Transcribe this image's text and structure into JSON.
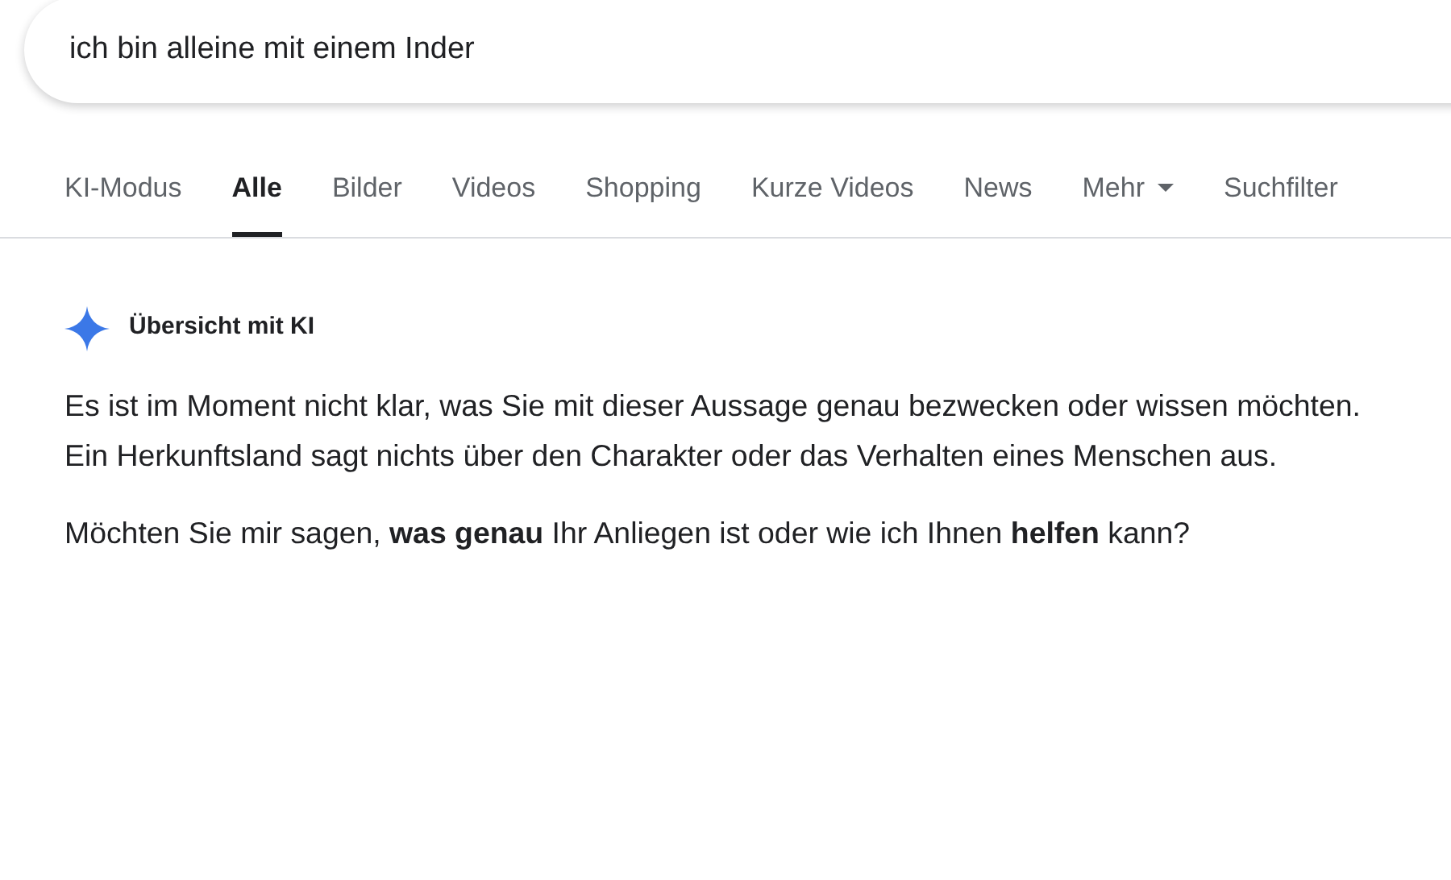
{
  "search": {
    "value": "ich bin alleine mit einem Inder"
  },
  "tabs": [
    {
      "label": "KI-Modus",
      "selected": false,
      "dropdown": false
    },
    {
      "label": "Alle",
      "selected": true,
      "dropdown": false
    },
    {
      "label": "Bilder",
      "selected": false,
      "dropdown": false
    },
    {
      "label": "Videos",
      "selected": false,
      "dropdown": false
    },
    {
      "label": "Shopping",
      "selected": false,
      "dropdown": false
    },
    {
      "label": "Kurze Videos",
      "selected": false,
      "dropdown": false
    },
    {
      "label": "News",
      "selected": false,
      "dropdown": false
    },
    {
      "label": "Mehr",
      "selected": false,
      "dropdown": true
    },
    {
      "label": "Suchfilter",
      "selected": false,
      "dropdown": false
    }
  ],
  "ai_overview": {
    "title": "Übersicht mit KI",
    "paragraphs": [
      "Es ist im Moment nicht klar, was Sie mit dieser Aussage genau bezwecken oder wissen möchten. Ein Herkunftsland sagt nichts über den Charakter oder das Verhalten eines Menschen aus.",
      "Möchten Sie mir sagen, **was genau** Ihr Anliegen ist oder wie ich Ihnen **helfen** kann?"
    ]
  }
}
